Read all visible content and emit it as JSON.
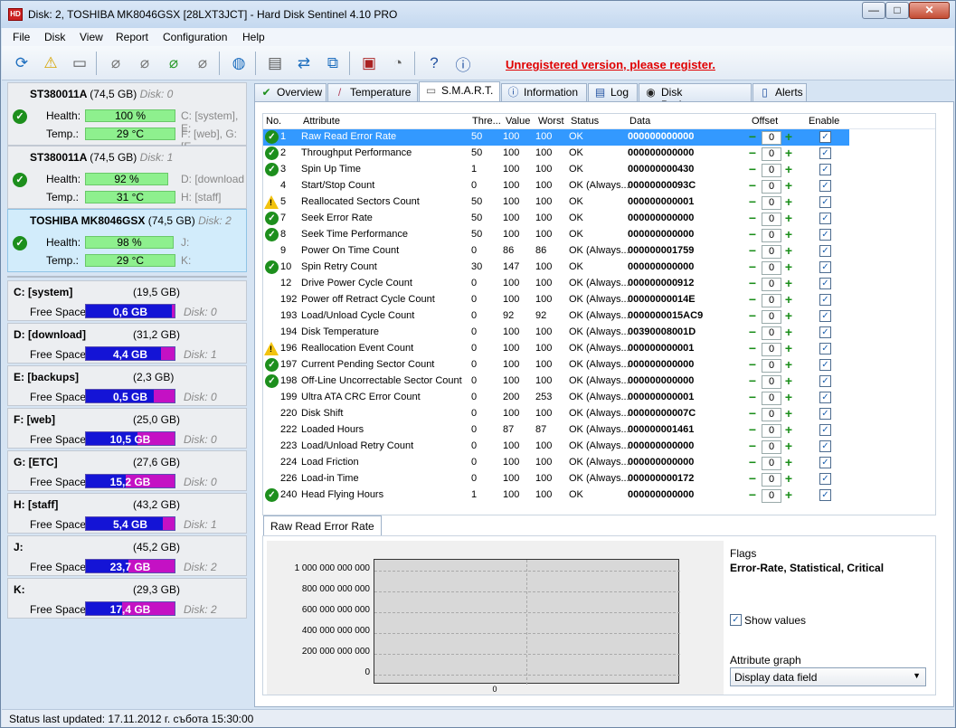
{
  "window": {
    "title": "Disk: 2, TOSHIBA MK8046GSX [28LXT3JCT]  -  Hard Disk Sentinel 4.10 PRO"
  },
  "menu": [
    "File",
    "Disk",
    "View",
    "Report",
    "Configuration",
    "Help"
  ],
  "toolbar": {
    "register_text": "Unregistered version, please register."
  },
  "disks": [
    {
      "name": "ST380011A",
      "size": "(74,5 GB)",
      "index": "Disk: 0",
      "health_label": "Health:",
      "health": "100 %",
      "health_pct": 100,
      "temp_label": "Temp.:",
      "temp": "29 °C",
      "vol1": "C: [system], E:",
      "vol2": "F: [web], G: [E"
    },
    {
      "name": "ST380011A",
      "size": "(74,5 GB)",
      "index": "Disk: 1",
      "health_label": "Health:",
      "health": "92 %",
      "health_pct": 92,
      "temp_label": "Temp.:",
      "temp": "31 °C",
      "vol1": "D: [download",
      "vol2": "H: [staff]"
    },
    {
      "name": "TOSHIBA MK8046GSX",
      "size": "(74,5 GB)",
      "index": "Disk: 2",
      "health_label": "Health:",
      "health": "98 %",
      "health_pct": 98,
      "temp_label": "Temp.:",
      "temp": "29 °C",
      "vol1": "J:",
      "vol2": "K:"
    }
  ],
  "partitions": [
    {
      "name": "C: [system]",
      "size": "(19,5 GB)",
      "free_label": "Free Space",
      "free": "0,6 GB",
      "fill_pct": 97,
      "disk": "Disk: 0"
    },
    {
      "name": "D: [download]",
      "size": "(31,2 GB)",
      "free_label": "Free Space",
      "free": "4,4 GB",
      "fill_pct": 85,
      "disk": "Disk: 1"
    },
    {
      "name": "E: [backups]",
      "size": "(2,3 GB)",
      "free_label": "Free Space",
      "free": "0,5 GB",
      "fill_pct": 77,
      "disk": "Disk: 0"
    },
    {
      "name": "F: [web]",
      "size": "(25,0 GB)",
      "free_label": "Free Space",
      "free": "10,5 GB",
      "fill_pct": 58,
      "disk": "Disk: 0"
    },
    {
      "name": "G: [ETC]",
      "size": "(27,6 GB)",
      "free_label": "Free Space",
      "free": "15,2 GB",
      "fill_pct": 45,
      "disk": "Disk: 0"
    },
    {
      "name": "H: [staff]",
      "size": "(43,2 GB)",
      "free_label": "Free Space",
      "free": "5,4 GB",
      "fill_pct": 87,
      "disk": "Disk: 1"
    },
    {
      "name": "J:",
      "size": "(45,2 GB)",
      "free_label": "Free Space",
      "free": "23,7 GB",
      "fill_pct": 48,
      "disk": "Disk: 2"
    },
    {
      "name": "K:",
      "size": "(29,3 GB)",
      "free_label": "Free Space",
      "free": "17,4 GB",
      "fill_pct": 41,
      "disk": "Disk: 2"
    }
  ],
  "tabs": [
    "Overview",
    "Temperature",
    "S.M.A.R.T.",
    "Information",
    "Log",
    "Disk Performance",
    "Alerts"
  ],
  "smart_headers": {
    "no": "No.",
    "attribute": "Attribute",
    "thre": "Thre...",
    "value": "Value",
    "worst": "Worst",
    "status": "Status",
    "data": "Data",
    "offset": "Offset",
    "enable": "Enable"
  },
  "smart_rows": [
    {
      "icon": "ok",
      "no": "1",
      "attr": "Raw Read Error Rate",
      "thre": "50",
      "value": "100",
      "worst": "100",
      "status": "OK",
      "data": "000000000000",
      "offset": "0"
    },
    {
      "icon": "ok",
      "no": "2",
      "attr": "Throughput Performance",
      "thre": "50",
      "value": "100",
      "worst": "100",
      "status": "OK",
      "data": "000000000000",
      "offset": "0"
    },
    {
      "icon": "ok",
      "no": "3",
      "attr": "Spin Up Time",
      "thre": "1",
      "value": "100",
      "worst": "100",
      "status": "OK",
      "data": "000000000430",
      "offset": "0"
    },
    {
      "icon": "",
      "no": "4",
      "attr": "Start/Stop Count",
      "thre": "0",
      "value": "100",
      "worst": "100",
      "status": "OK (Always...",
      "data": "00000000093C",
      "offset": "0"
    },
    {
      "icon": "warn",
      "no": "5",
      "attr": "Reallocated Sectors Count",
      "thre": "50",
      "value": "100",
      "worst": "100",
      "status": "OK",
      "data": "000000000001",
      "offset": "0"
    },
    {
      "icon": "ok",
      "no": "7",
      "attr": "Seek Error Rate",
      "thre": "50",
      "value": "100",
      "worst": "100",
      "status": "OK",
      "data": "000000000000",
      "offset": "0"
    },
    {
      "icon": "ok",
      "no": "8",
      "attr": "Seek Time Performance",
      "thre": "50",
      "value": "100",
      "worst": "100",
      "status": "OK",
      "data": "000000000000",
      "offset": "0"
    },
    {
      "icon": "",
      "no": "9",
      "attr": "Power On Time Count",
      "thre": "0",
      "value": "86",
      "worst": "86",
      "status": "OK (Always...",
      "data": "000000001759",
      "offset": "0"
    },
    {
      "icon": "ok",
      "no": "10",
      "attr": "Spin Retry Count",
      "thre": "30",
      "value": "147",
      "worst": "100",
      "status": "OK",
      "data": "000000000000",
      "offset": "0"
    },
    {
      "icon": "",
      "no": "12",
      "attr": "Drive Power Cycle Count",
      "thre": "0",
      "value": "100",
      "worst": "100",
      "status": "OK (Always...",
      "data": "000000000912",
      "offset": "0"
    },
    {
      "icon": "",
      "no": "192",
      "attr": "Power off Retract Cycle Count",
      "thre": "0",
      "value": "100",
      "worst": "100",
      "status": "OK (Always...",
      "data": "00000000014E",
      "offset": "0"
    },
    {
      "icon": "",
      "no": "193",
      "attr": "Load/Unload Cycle Count",
      "thre": "0",
      "value": "92",
      "worst": "92",
      "status": "OK (Always...",
      "data": "0000000015AC9",
      "offset": "0"
    },
    {
      "icon": "",
      "no": "194",
      "attr": "Disk Temperature",
      "thre": "0",
      "value": "100",
      "worst": "100",
      "status": "OK (Always...",
      "data": "00390008001D",
      "offset": "0"
    },
    {
      "icon": "warn",
      "no": "196",
      "attr": "Reallocation Event Count",
      "thre": "0",
      "value": "100",
      "worst": "100",
      "status": "OK (Always...",
      "data": "000000000001",
      "offset": "0"
    },
    {
      "icon": "ok",
      "no": "197",
      "attr": "Current Pending Sector Count",
      "thre": "0",
      "value": "100",
      "worst": "100",
      "status": "OK (Always...",
      "data": "000000000000",
      "offset": "0"
    },
    {
      "icon": "ok",
      "no": "198",
      "attr": "Off-Line Uncorrectable Sector Count",
      "thre": "0",
      "value": "100",
      "worst": "100",
      "status": "OK (Always...",
      "data": "000000000000",
      "offset": "0"
    },
    {
      "icon": "",
      "no": "199",
      "attr": "Ultra ATA CRC Error Count",
      "thre": "0",
      "value": "200",
      "worst": "253",
      "status": "OK (Always...",
      "data": "000000000001",
      "offset": "0"
    },
    {
      "icon": "",
      "no": "220",
      "attr": "Disk Shift",
      "thre": "0",
      "value": "100",
      "worst": "100",
      "status": "OK (Always...",
      "data": "00000000007C",
      "offset": "0"
    },
    {
      "icon": "",
      "no": "222",
      "attr": "Loaded Hours",
      "thre": "0",
      "value": "87",
      "worst": "87",
      "status": "OK (Always...",
      "data": "000000001461",
      "offset": "0"
    },
    {
      "icon": "",
      "no": "223",
      "attr": "Load/Unload Retry Count",
      "thre": "0",
      "value": "100",
      "worst": "100",
      "status": "OK (Always...",
      "data": "000000000000",
      "offset": "0"
    },
    {
      "icon": "",
      "no": "224",
      "attr": "Load Friction",
      "thre": "0",
      "value": "100",
      "worst": "100",
      "status": "OK (Always...",
      "data": "000000000000",
      "offset": "0"
    },
    {
      "icon": "",
      "no": "226",
      "attr": "Load-in Time",
      "thre": "0",
      "value": "100",
      "worst": "100",
      "status": "OK (Always...",
      "data": "000000000172",
      "offset": "0"
    },
    {
      "icon": "ok",
      "no": "240",
      "attr": "Head Flying Hours",
      "thre": "1",
      "value": "100",
      "worst": "100",
      "status": "OK",
      "data": "000000000000",
      "offset": "0"
    }
  ],
  "graph": {
    "tab_label": "Raw Read Error Rate",
    "y_ticks": [
      "1 000 000 000 000",
      "800 000 000 000",
      "600 000 000 000",
      "400 000 000 000",
      "200 000 000 000",
      "0"
    ],
    "x_tick": "0",
    "flags_label": "Flags",
    "flags_value": "Error-Rate, Statistical, Critical",
    "show_values_label": "Show values",
    "attr_graph_label": "Attribute graph",
    "attr_graph_value": "Display data field"
  },
  "status": {
    "text": "Status last updated: 17.11.2012 г. събота 15:30:00"
  }
}
